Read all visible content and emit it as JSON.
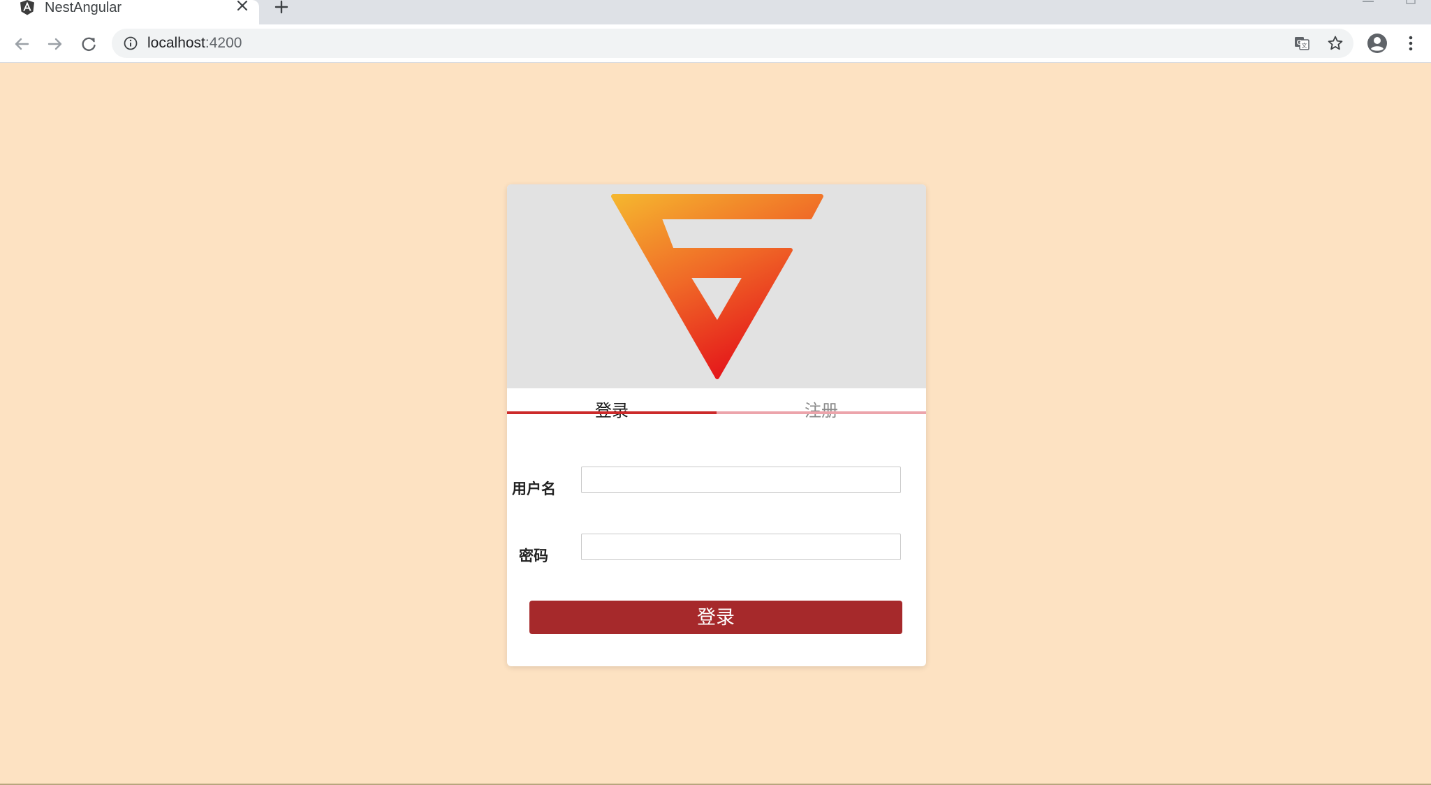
{
  "browser": {
    "tab": {
      "title": "NestAngular",
      "favicon_icon": "angular-logo-icon",
      "close_icon": "close-icon"
    },
    "new_tab_icon": "plus-icon",
    "toolbar": {
      "back_icon": "arrow-left-icon",
      "forward_icon": "arrow-right-icon",
      "reload_icon": "reload-icon",
      "info_icon": "info-icon",
      "url_host": "localhost",
      "url_port": ":4200",
      "translate_icon": "translate-icon",
      "bookmark_icon": "star-icon",
      "profile_icon": "account-circle-icon",
      "menu_icon": "more-vert-icon"
    }
  },
  "page": {
    "background_color": "#fde2c2",
    "logo_icon": "brand-v-logo-icon",
    "tabs": [
      {
        "label": "登录",
        "active": true
      },
      {
        "label": "注册",
        "active": false
      }
    ],
    "form": {
      "username_label": "用户名",
      "username_value": "",
      "password_label": "密码",
      "password_value": "",
      "submit_label": "登录"
    },
    "colors": {
      "accent": "#a6292b",
      "tab_underline_active": "#cc2a2a",
      "tab_underline_inactive": "#eca4ab",
      "banner": "#e2e2e2"
    }
  }
}
